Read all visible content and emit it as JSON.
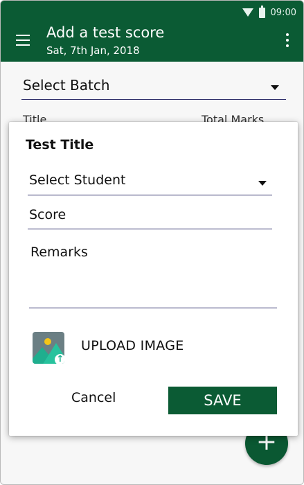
{
  "status_bar": {
    "time": "09:00",
    "wifi_icon": "wifi-icon",
    "battery_icon": "battery-icon"
  },
  "app_bar": {
    "title": "Add a test score",
    "subtitle": "Sat, 7th Jan, 2018",
    "menu_icon": "hamburger-menu-icon",
    "overflow_icon": "more-vert-icon",
    "color": "#0b5b34"
  },
  "background": {
    "batch_select": {
      "value": "Select Batch"
    },
    "columns": [
      "Title",
      "Total Marks"
    ],
    "fab_label": "+"
  },
  "dialog": {
    "title": "Test Title",
    "student_select": {
      "value": "Select Student"
    },
    "score_field": {
      "placeholder": "Score"
    },
    "remarks_field": {
      "placeholder": "Remarks"
    },
    "upload_label": "UPLOAD IMAGE",
    "upload_icon": "image-upload-icon",
    "cancel_label": "Cancel",
    "save_label": "SAVE"
  }
}
